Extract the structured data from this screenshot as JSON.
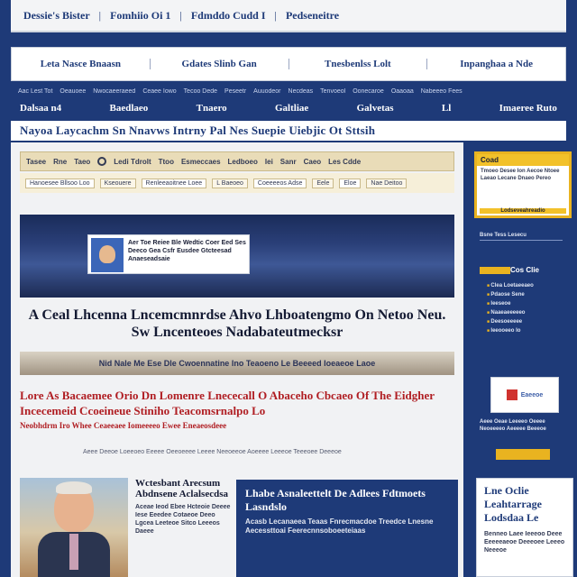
{
  "top_strip": {
    "items": [
      "Dessie's Bister",
      "Fomhiio Oi 1",
      "Fdmddo Cudd I",
      "Pedseneitre"
    ]
  },
  "section_nav": {
    "items": [
      "Leta Nasce Bnaasn",
      "Gdates Slinb Gan",
      "Tnesbenlss Lolt",
      "Inpanghaa a Nde"
    ]
  },
  "ticker": [
    "Aac Lest Tot",
    "Oeauoee",
    "Nwocaeeraeed",
    "Ceaee Iowo",
    "Tecoo Dede",
    "Peseetr",
    "Auuodeor",
    "Necdeas",
    "Tenvoeol",
    "Oonecaroe",
    "Oaaoaa",
    "Nabeeeo Fees"
  ],
  "main_nav": {
    "items": [
      "Dalsaa n4",
      "Baedlaeo",
      "Tnaero",
      "Galtliae",
      "Galvetas",
      "Ll",
      "Imaeree Ruto"
    ]
  },
  "banner": {
    "text": "Nayoa Laycachm Sn Nnavws Intrny Pal Nes Suepie Uiebjic Ot Sttsih"
  },
  "toolbar": {
    "items": [
      "Tasee",
      "Rne",
      "Taeo",
      "Ledi Tdrolt",
      "Ttoo",
      "Esmeccaes",
      "Ledboeo",
      "Iei",
      "Sanr",
      "Caeo",
      "Les Cdde"
    ]
  },
  "filters": [
    "Hanoesee Bllsoo Loo",
    "Kseouere",
    "Renleeaoitnee Loee",
    "L Baeoeo",
    "Coeeeeos Adse",
    "Eele",
    "Eloe",
    "Nae Deitoo"
  ],
  "hero_card": {
    "text": "Aer Toe Reiee Ble Wedtic Coer Eed Ses Deeco Gea Csfr Eusdee Gtcteesad Anaeseadsaie"
  },
  "headline": {
    "text": "A Ceal Lhcenna Lncemcmnrdse Ahvo Lhboatengmo On Netoo Neu. Sw Lncenteoes Nadabateutmecksr"
  },
  "strap": {
    "text": "Nid Nale Me Ese Dle Cwoennatine Ino Teaoeno Le Beeeed Ioeaeoe Laoe"
  },
  "dek": {
    "text": "Lore As Bacaemee Orio Dn Lomenre Lnececall O Abaceho Cbcaeo Of The Eidgher Incecemeid Ccoeineue Stiniho Teacomsrnalpo Lo",
    "small": "Neobhdrm Iro Whee Ceaeeaee Iomeeeeo Ewee Eneaeosdeee"
  },
  "byline": {
    "text": "Aeee Deeoe Loeeoeo Eeeee Oeeoeeee Leeee Neeoeeoe Aoeeee Leeeoe Teeeoee Deeeoe"
  },
  "story": {
    "title": "Wctesbant Arecsum Abdnsene Aclalsecdsa",
    "body": "Aceae Ieod Ebee Hcteoie Deeee Iese Eeedee Cotaeoe Deeo Lgcea Leeteoe Sitco Leeeos Daeee"
  },
  "promo": {
    "title": "Lhabe Asnaleettelt De Adlees Fdtmoets Lasndslo",
    "body": "Acasb Lecanaeea Teaas Fnrecmacdoe Treedce Lnesne Aecessttoai Feerecnnsoboeeteiaas"
  },
  "sidebar": {
    "card_title": "Coad",
    "card_body": "Tmoeo Desee Ion Aecoe Ntoee Laeao Lecane Dnaeo Pereo",
    "card_footer": "Lodseveahreadio",
    "label": "Bsne Tess Lesecu",
    "more_label": "Cos Clie",
    "list": [
      "Clea Loetaeeaeo",
      "Pdaose Sene",
      "Ieeseoe",
      "Naaeaeeeeeo",
      "Deesoeeeee",
      "Ieeooeeo Io"
    ],
    "ad_text": "Eaeeoe",
    "note": "Aeee Oeae Leeeeo Oeeee Neoeeeeo Aeeeee Beeeoe"
  },
  "side_box": {
    "title": "Lne Oclie Leahtarrage Lodsdaa Le",
    "body": "Benneo Laee Ieeeoo Deee Eeeeeaeoe Deeeoee Leeeo Neeeoe"
  },
  "colors": {
    "page_blue": "#1e3a78",
    "accent_red": "#b01e23",
    "accent_gold": "#e9b320",
    "toolbar_tan": "#e9dcb8"
  }
}
